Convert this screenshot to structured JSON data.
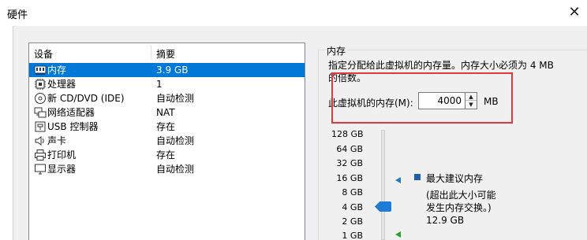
{
  "window": {
    "title": "硬件",
    "close_glyph": "✕"
  },
  "device_list": {
    "headers": {
      "device": "设备",
      "summary": "摘要"
    },
    "rows": [
      {
        "icon": "memory-icon",
        "name": "内存",
        "summary": "3.9 GB",
        "selected": true
      },
      {
        "icon": "cpu-icon",
        "name": "处理器",
        "summary": "1"
      },
      {
        "icon": "cd-dvd-icon",
        "name": "新 CD/DVD (IDE)",
        "summary": "自动检测"
      },
      {
        "icon": "network-icon",
        "name": "网络适配器",
        "summary": "NAT"
      },
      {
        "icon": "usb-icon",
        "name": "USB 控制器",
        "summary": "存在"
      },
      {
        "icon": "sound-icon",
        "name": "声卡",
        "summary": "自动检测"
      },
      {
        "icon": "printer-icon",
        "name": "打印机",
        "summary": "存在"
      },
      {
        "icon": "display-icon",
        "name": "显示器",
        "summary": "自动检测"
      }
    ]
  },
  "memory_panel": {
    "title": "内存",
    "description_line1": "指定分配给此虚拟机的内存量。内存大小必须为 4 MB",
    "description_line2": "的倍数。",
    "memory_label": "此虚拟机的内存(M):",
    "memory_value": "4000",
    "unit": "MB",
    "scale_ticks": [
      "128 GB",
      "64 GB",
      "32 GB",
      "16 GB",
      "8 GB",
      "4 GB",
      "2 GB",
      "1 GB"
    ],
    "slider_value": "4 GB",
    "recommended_max_label": "最大建议内存",
    "recommended_note_line1": "(超出此大小可能",
    "recommended_note_line2": "发生内存交换。)",
    "recommended_max_value": "12.9 GB",
    "colors": {
      "selection": "#0078d7",
      "highlight_box": "#e0393e",
      "slider": "#1e7bd6",
      "recommended_marker": "#1e5fb0",
      "minimum_marker": "#2aa12a"
    }
  }
}
